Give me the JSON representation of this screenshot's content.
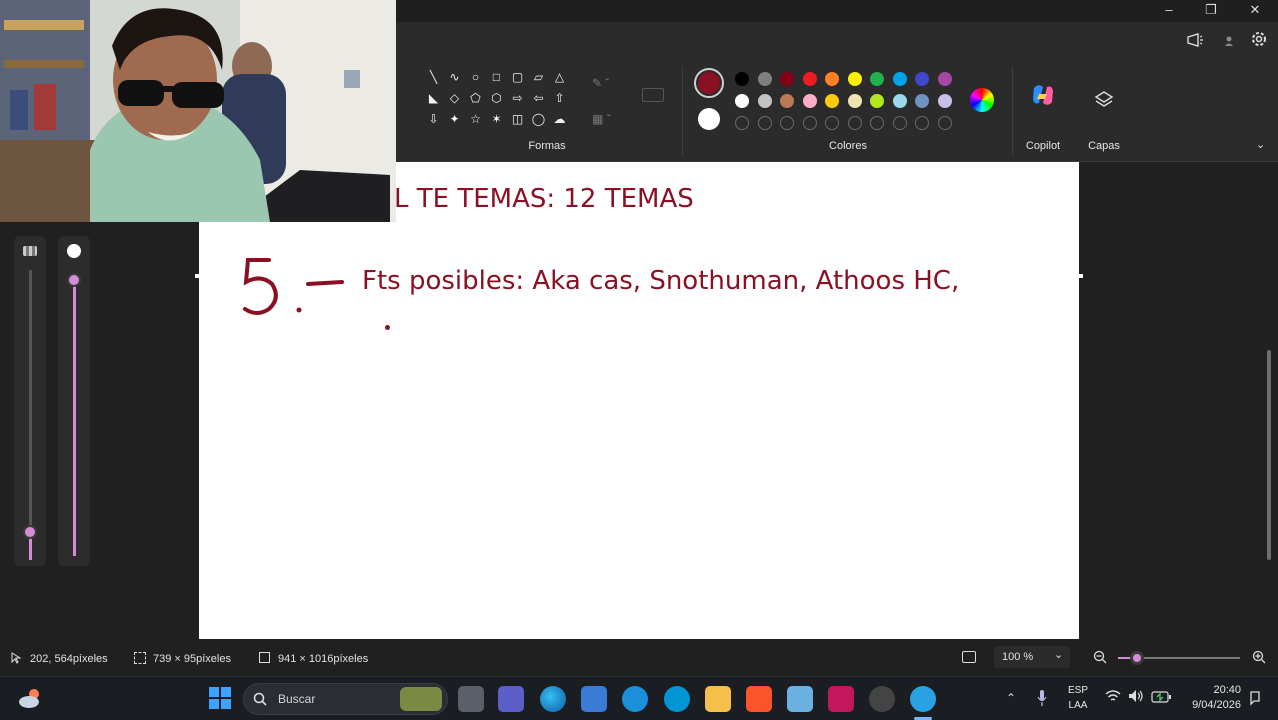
{
  "ribbon": {
    "shapes_label": "Formas",
    "colors_label": "Colores",
    "copilot_label": "Copilot",
    "layers_label": "Capas",
    "selected_color": "#8b1023",
    "secondary_color": "#ffffff",
    "palette_row1": [
      "#000000",
      "#7f7f7f",
      "#880015",
      "#ed1c24",
      "#ff7f27",
      "#fff200",
      "#22b14c",
      "#00a2e8",
      "#3f48cc",
      "#a349a4"
    ],
    "palette_row2": [
      "#ffffff",
      "#c3c3c3",
      "#b97a57",
      "#ffaec9",
      "#ffc90e",
      "#efe4b0",
      "#b5e61d",
      "#99d9ea",
      "#7092be",
      "#c8bfe7"
    ]
  },
  "canvas": {
    "line1": "L TE TEMAS: 12 TEMAS",
    "handwritten_number": "5.-",
    "line2": "Fts posibles: Aka cas, Snothuman, Athoos HC,"
  },
  "statusbar": {
    "cursor_position": "202, 564píxeles",
    "selection_size": "739 × 95píxeles",
    "image_size": "941 × 1016píxeles",
    "zoom": "100 %"
  },
  "taskbar": {
    "search_placeholder": "Buscar",
    "language_top": "ESP",
    "language_bottom": "LAA",
    "time": "20:40",
    "date": "9/04/2026"
  }
}
